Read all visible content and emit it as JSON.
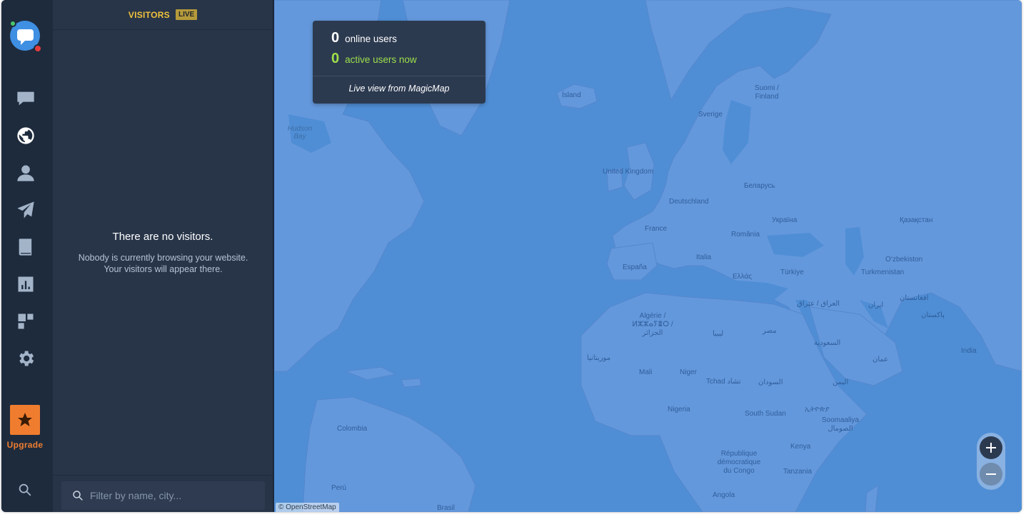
{
  "rail": {
    "items": [
      {
        "name": "chat-icon",
        "active": false
      },
      {
        "name": "globe-icon",
        "active": true
      },
      {
        "name": "user-icon",
        "active": false
      },
      {
        "name": "paper-plane-icon",
        "active": false
      },
      {
        "name": "book-icon",
        "active": false
      },
      {
        "name": "bar-chart-icon",
        "active": false
      },
      {
        "name": "plugins-icon",
        "active": false
      },
      {
        "name": "gear-icon",
        "active": false
      }
    ],
    "upgrade_label": "Upgrade"
  },
  "panel": {
    "title": "VISITORS",
    "badge": "LIVE",
    "empty_title": "There are no visitors.",
    "empty_description": "Nobody is currently browsing your website. Your visitors will appear there.",
    "filter_placeholder": "Filter by name, city..."
  },
  "stats": {
    "online_count": "0",
    "online_label": "online users",
    "active_count": "0",
    "active_label": "active users now",
    "caption": "Live view from MagicMap"
  },
  "map": {
    "credit": "© OpenStreetMap",
    "labels": [
      "Ísland",
      "Suomi / Finland",
      "Sverige",
      "Hudson Bay",
      "United Kingdom",
      "Беларусь",
      "Deutschland",
      "Україна",
      "Қазақстан",
      "France",
      "România",
      "Italia",
      "O‘zbekiston",
      "España",
      "Ελλάς",
      "Türkiye",
      "Turkmenistan",
      "العراق / عێراق",
      "ایران",
      "افغانستان",
      "Algérie / ⵍⵣⵣⴰⵢⴻⵔ / الجزائر",
      "پاکستان",
      "ليبيا",
      "مصر",
      "السعودية",
      "India",
      "موريتانيا",
      "عمان",
      "Mali",
      "Niger",
      "Tchad تشاد",
      "السودان",
      "اليمن",
      "Nigeria",
      "South Sudan",
      "ኢትዮጵያ",
      "Soomaaliya الصومال",
      "Colombia",
      "Kenya",
      "République démocratique du Congo",
      "Tanzania",
      "Perú",
      "Angola",
      "Brasil"
    ]
  },
  "colors": {
    "ocean": "#4f8ed5",
    "land": "#6498dc",
    "accent_orange": "#f07d2f",
    "live_yellow": "#f0c33c",
    "active_green": "#9ee04a"
  }
}
